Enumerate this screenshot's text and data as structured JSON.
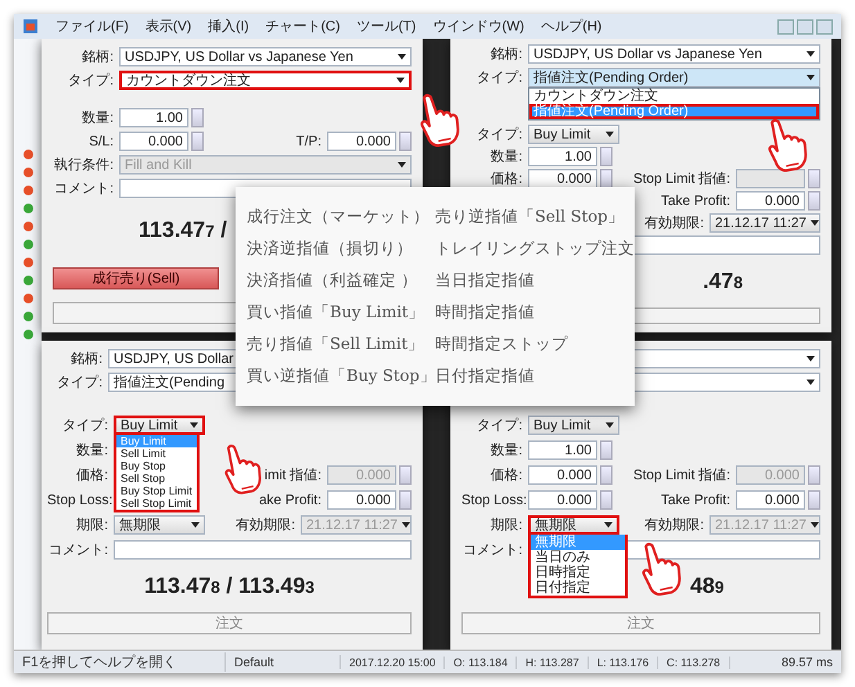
{
  "menu": [
    "ファイル(F)",
    "表示(V)",
    "挿入(I)",
    "チャート(C)",
    "ツール(T)",
    "ウインドウ(W)",
    "ヘルプ(H)"
  ],
  "market_watch": [
    {
      "color": "#e8502a"
    },
    {
      "color": "#e8502a"
    },
    {
      "color": "#e8502a"
    },
    {
      "color": "#3aa83a"
    },
    {
      "color": "#e8502a"
    },
    {
      "color": "#3aa83a"
    },
    {
      "color": "#e8502a"
    },
    {
      "color": "#3aa83a"
    },
    {
      "color": "#e8502a"
    },
    {
      "color": "#3aa83a"
    },
    {
      "color": "#3aa83a"
    }
  ],
  "dialogs": [
    {
      "header": [
        {
          "label": "銘柄:",
          "value": "USDJPY, US Dollar vs Japanese Yen",
          "highlighted": false
        },
        {
          "label": "タイプ:",
          "value": "カウントダウン注文",
          "highlighted": true
        }
      ],
      "rows": [
        {
          "left": {
            "label": "数量:",
            "value": "1.00",
            "kind": "spin",
            "disabled": false
          }
        },
        {
          "left": {
            "label": "S/L:",
            "value": "0.000",
            "kind": "spin",
            "disabled": false
          },
          "right": {
            "label": "T/P:",
            "value": "0.000",
            "kind": "spin",
            "disabled": false
          }
        },
        {
          "left": {
            "label": "執行条件:",
            "value": "Fill and Kill",
            "kind": "select-wide",
            "disabled": true
          }
        },
        {
          "left": {
            "label": "コメント:",
            "kind": "text-wide",
            "disabled": false
          }
        }
      ],
      "quote": {
        "bid": "113.47",
        "bid_pip": "7",
        "separator": "/"
      },
      "buttons": [
        {
          "label": "成行売り(Sell)",
          "kind": "sell"
        },
        {
          "kind": "blank"
        }
      ]
    },
    {
      "header": [
        {
          "label": "銘柄:",
          "value": "USDJPY, US Dollar vs Japanese Yen",
          "highlighted": false
        },
        {
          "label": "タイプ:",
          "value": "指値注文(Pending Order)",
          "highlighted": false,
          "options": [
            {
              "label": "カウントダウン注文",
              "selected": false,
              "highlighted": false
            },
            {
              "label": "指値注文(Pending Order)",
              "selected": true,
              "highlighted": true
            }
          ]
        }
      ],
      "rows": [
        {
          "left": {
            "label": "タイプ:",
            "value": "Buy Limit",
            "kind": "select",
            "disabled": false
          }
        },
        {
          "left": {
            "label": "数量:",
            "value": "1.00",
            "kind": "spin",
            "disabled": false
          }
        },
        {
          "left": {
            "label": "価格:",
            "value": "0.000",
            "kind": "spin",
            "disabled": false
          },
          "right": {
            "label": "Stop Limit 指値:",
            "kind": "spin",
            "disabled": true
          }
        },
        {
          "right": {
            "label": "Take Profit:",
            "value": "0.000",
            "kind": "spin",
            "disabled": false
          }
        },
        {
          "right": {
            "label": "有効期限:",
            "value": "21.12.17 11:27",
            "kind": "select",
            "disabled": false
          }
        },
        {
          "left": {
            "kind": "text-wide",
            "disabled": false
          }
        }
      ],
      "quote": {
        "bid": ".47",
        "bid_pip": "8"
      },
      "buttons": [
        {
          "kind": "blank"
        }
      ]
    },
    {
      "header": [
        {
          "label": "銘柄:",
          "value": "USDJPY, US Dollar",
          "highlighted": false
        },
        {
          "label": "タイプ:",
          "value": "指値注文(Pending",
          "highlighted": false
        }
      ],
      "rows": [
        {
          "left": {
            "label": "タイプ:",
            "value": "Buy Limit",
            "kind": "select",
            "disabled": false,
            "highlighted": true,
            "options": [
              {
                "label": "Buy Limit",
                "selected": true
              },
              {
                "label": "Sell Limit",
                "selected": false
              },
              {
                "label": "Buy Stop",
                "selected": false
              },
              {
                "label": "Sell Stop",
                "selected": false
              },
              {
                "label": "Buy Stop Limit",
                "selected": false
              },
              {
                "label": "Sell Stop Limit",
                "selected": false
              }
            ]
          }
        },
        {
          "left": {
            "label": "数量:",
            "kind": "label"
          }
        },
        {
          "left": {
            "label": "価格:",
            "kind": "label"
          },
          "right": {
            "label": "imit 指値:",
            "value": "0.000",
            "kind": "spin",
            "disabled": true
          }
        },
        {
          "left": {
            "label": "Stop Loss:",
            "kind": "label"
          },
          "right": {
            "label": "ake Profit:",
            "value": "0.000",
            "kind": "spin",
            "disabled": false
          }
        },
        {
          "left": {
            "label": "期限:",
            "value": "無期限",
            "kind": "select",
            "disabled": false
          },
          "right": {
            "label": "有効期限:",
            "value": "21.12.17 11:27",
            "kind": "select",
            "disabled": true
          }
        },
        {
          "left": {
            "label": "コメント:",
            "kind": "text-wide",
            "disabled": false
          }
        }
      ],
      "quote": {
        "bid": "113.47",
        "bid_pip": "8",
        "separator": "/",
        "ask": "113.49",
        "ask_pip": "3"
      },
      "buttons": [
        {
          "label": "注文",
          "kind": "order"
        }
      ]
    },
    {
      "header": [
        {
          "highlighted": false
        },
        {
          "highlighted": false
        }
      ],
      "rows": [
        {
          "left": {
            "label": "タイプ:",
            "value": "Buy Limit",
            "kind": "select",
            "disabled": false
          }
        },
        {
          "left": {
            "label": "数量:",
            "value": "1.00",
            "kind": "spin",
            "disabled": false
          }
        },
        {
          "left": {
            "label": "価格:",
            "value": "0.000",
            "kind": "spin",
            "disabled": false
          },
          "right": {
            "label": "Stop Limit 指値:",
            "value": "0.000",
            "kind": "spin",
            "disabled": true
          }
        },
        {
          "left": {
            "label": "Stop Loss:",
            "value": "0.000",
            "kind": "spin",
            "disabled": false
          },
          "right": {
            "label": "Take Profit:",
            "value": "0.000",
            "kind": "spin",
            "disabled": false
          }
        },
        {
          "left": {
            "label": "期限:",
            "value": "無期限",
            "kind": "select",
            "disabled": false,
            "highlighted": true,
            "options": [
              {
                "label": "無期限",
                "selected": true
              },
              {
                "label": "当日のみ",
                "selected": false
              },
              {
                "label": "日時指定",
                "selected": false
              },
              {
                "label": "日付指定",
                "selected": false
              }
            ]
          },
          "right": {
            "label": "有効期限:",
            "value": "21.12.17 11:27",
            "kind": "select",
            "disabled": true
          }
        },
        {
          "left": {
            "label": "コメント:",
            "kind": "text-wide",
            "disabled": false
          }
        }
      ],
      "quote": {
        "ask": "48",
        "ask_pip": "9"
      },
      "buttons": [
        {
          "label": "注文",
          "kind": "order"
        }
      ]
    }
  ],
  "order_types": [
    "成行注文（マーケット）",
    "売り逆指値「Sell Stop」",
    "決済逆指値（損切り）",
    "トレイリングストップ注文",
    "決済指値（利益確定 ）",
    "当日指定指値",
    "買い指値「Buy Limit」",
    "時間指定指値",
    "売り指値「Sell Limit」",
    "時間指定ストップ",
    "買い逆指値「Buy Stop」",
    "日付指定指値"
  ],
  "status_bar": [
    "F1を押してヘルプを開く",
    "Default",
    "2017.12.20 15:00",
    "O: 113.184",
    "H: 113.287",
    "L: 113.176",
    "C: 113.278",
    "89.57 ms"
  ]
}
